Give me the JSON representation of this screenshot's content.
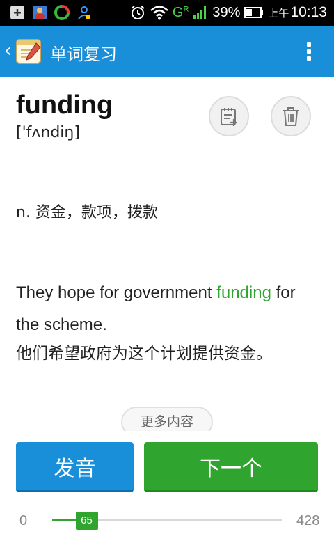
{
  "status_bar": {
    "battery": "39%",
    "ampm": "上午",
    "time": "10:13",
    "network": "G",
    "network_sub": "R"
  },
  "app_bar": {
    "back_glyph": "‹",
    "title": "单词复习",
    "color": "#1a8fd9"
  },
  "word": {
    "text": "funding",
    "phonetic": "['fʌndiŋ]",
    "definition": "n. 资金，款项，拨款",
    "example_before": "They hope for government ",
    "example_highlight": "funding",
    "example_after": " for the scheme.",
    "translation": "他们希望政府为这个计划提供资金。",
    "highlight_color": "#2fa52f"
  },
  "actions": {
    "more": "更多内容",
    "pronounce": "发音",
    "next": "下一个"
  },
  "progress": {
    "min": "0",
    "max": "428",
    "current": "65",
    "fraction": 0.15
  }
}
